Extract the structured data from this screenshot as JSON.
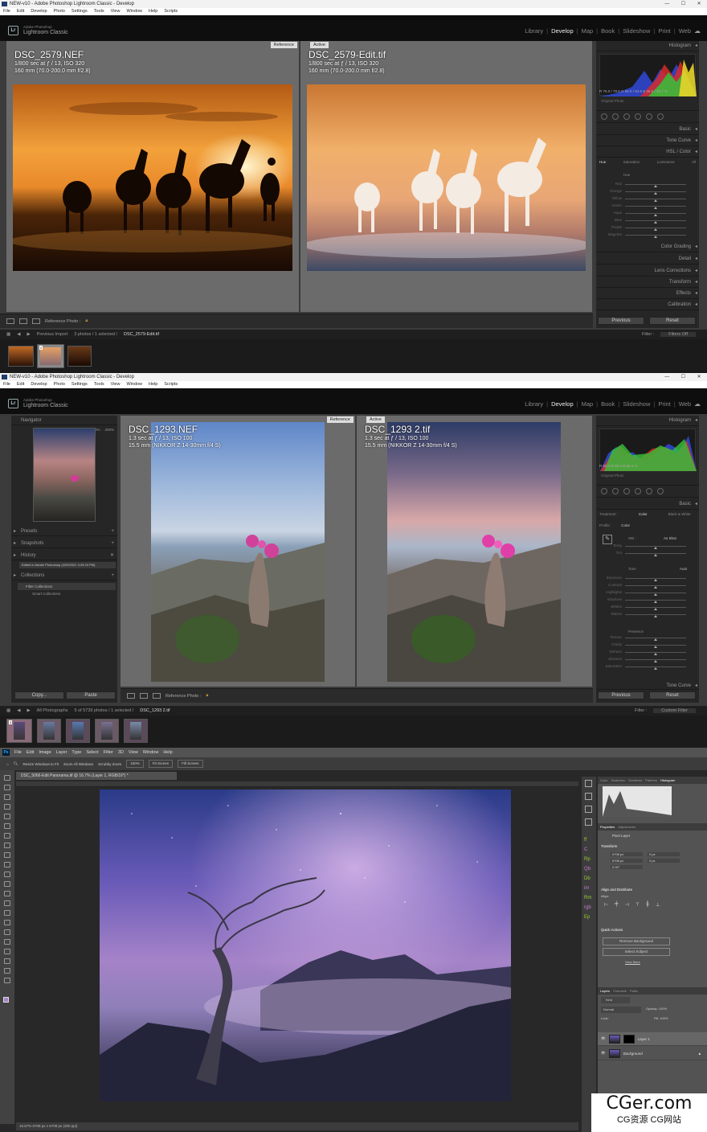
{
  "lr1": {
    "window_title": "NEW-v10 - Adobe Photoshop Lightroom Classic - Develop",
    "menus": [
      "File",
      "Edit",
      "Develop",
      "Photo",
      "Settings",
      "Tools",
      "View",
      "Window",
      "Help",
      "Scripts"
    ],
    "app_small": "Adobe Photoshop",
    "app_name": "Lightroom Classic",
    "modules": [
      "Library",
      "Develop",
      "Map",
      "Book",
      "Slideshow",
      "Print",
      "Web"
    ],
    "active_module": "Develop",
    "reference_tag": "Reference",
    "active_tag": "Active",
    "ref_file": "DSC_2579.NEF",
    "ref_exposure": "1/800 sec at ƒ / 13, ISO 320",
    "ref_lens": "160 mm (70.0-200.0 mm f/2.8)",
    "act_file": "DSC_2579-Edit.tif",
    "act_exposure": "1/800 sec at ƒ / 13, ISO 320",
    "act_lens": "160 mm (70.0-200.0 mm f/2.8)",
    "histogram_title": "Histogram",
    "rgb_readout": "R 76.0 / 78.5  G 65.0 / 63.5  B 36.5 / 39.7 %",
    "original_photo": "Original Photo",
    "panels": [
      "Basic",
      "Tone Curve"
    ],
    "hsl_title": "HSL / Color",
    "hsl_tabs": [
      "Hue",
      "Saturation",
      "Luminance",
      "All"
    ],
    "hsl_label": "Hue",
    "hsl_sliders": [
      "Red",
      "Orange",
      "Yellow",
      "Green",
      "Aqua",
      "Blue",
      "Purple",
      "Magenta"
    ],
    "panels_after": [
      "Color Grading",
      "Detail",
      "Lens Corrections",
      "Transform",
      "Effects",
      "Calibration"
    ],
    "previous": "Previous",
    "reset": "Reset",
    "toolbar_ref": "Reference Photo :",
    "film_source": "Previous Import",
    "film_count": "3 photos / 1 selected /",
    "film_file": "DSC_2579-Edit.tif",
    "filter_label": "Filter :",
    "filter_value": "Filters Off",
    "thumb_badge": "2"
  },
  "lr2": {
    "window_title": "NEW-v10 - Adobe Photoshop Lightroom Classic - Develop",
    "menus": [
      "File",
      "Edit",
      "Develop",
      "Photo",
      "Settings",
      "Tools",
      "View",
      "Window",
      "Help",
      "Scripts"
    ],
    "app_small": "Adobe Photoshop",
    "app_name": "Lightroom Classic",
    "modules": [
      "Library",
      "Develop",
      "Map",
      "Book",
      "Slideshow",
      "Print",
      "Web"
    ],
    "active_module": "Develop",
    "navigator": "Navigator",
    "nav_zoom": [
      "FIT",
      "100%",
      "200%"
    ],
    "left_sections": [
      "Presets",
      "Snapshots",
      "History",
      "Collections"
    ],
    "history_item": "Edited in Adobe Photoshop (4/29/2021 4:29:23 PM)",
    "filter_collections": "Filter Collections",
    "smart_collections": "Smart Collections",
    "copy": "Copy...",
    "paste": "Paste",
    "reference_tag": "Reference",
    "active_tag": "Active",
    "ref_file": "DSC_1293.NEF",
    "ref_exposure": "1.3 sec at ƒ / 13, ISO 100",
    "ref_lens": "15.5 mm (NIKKOR Z 14-30mm f/4 S)",
    "act_file": "DSC_1293 2.tif",
    "act_exposure": "1.3 sec at ƒ / 13, ISO 100",
    "act_lens": "15.5 mm (NIKKOR Z 14-30mm f/4 S)",
    "histogram_title": "Histogram",
    "rgb_readout": "R 90.4  G 80.3  B 66.1 %",
    "original_photo": "Original Photo",
    "basic_title": "Basic",
    "treatment": "Treatment :",
    "color": "Color",
    "bw": "Black & White",
    "profile": "Profile :",
    "profile_value": "Color",
    "wb": "WB :",
    "wb_value": "As Shot",
    "tone": "Tone",
    "auto": "Auto",
    "presence": "Presence",
    "tone_sliders": [
      "Temp",
      "Tint",
      "Exposure",
      "Contrast",
      "Highlights",
      "Shadows",
      "Whites",
      "Blacks"
    ],
    "presence_sliders": [
      "Texture",
      "Clarity",
      "Dehaze",
      "Vibrance",
      "Saturation"
    ],
    "tone_curve": "Tone Curve",
    "previous": "Previous",
    "reset": "Reset",
    "toolbar_ref": "Reference Photo :",
    "film_source": "All Photographs",
    "film_count": "5 of 5739 photos / 1 selected /",
    "film_file": "DSC_1293 2.tif",
    "filter_label": "Filter :",
    "filter_value": "Custom Filter",
    "thumb_badge": "3"
  },
  "ps": {
    "menus": [
      "File",
      "Edit",
      "Image",
      "Layer",
      "Type",
      "Select",
      "Filter",
      "3D",
      "View",
      "Window",
      "Help"
    ],
    "options": [
      "Resize Windows to Fit",
      "Zoom All Windows",
      "Scrubby Zoom",
      "100%",
      "Fit Screen",
      "Fill Screen"
    ],
    "doc_tab": "DSC_5066-Edit Panorama.tif @ 16.7% (Layer 1, RGB/16*) *",
    "right_tabs": [
      "Color",
      "Swatches",
      "Gradients",
      "Patterns",
      "Histogram"
    ],
    "prop_tabs": [
      "Properties",
      "Adjustments"
    ],
    "pixel_layer": "Pixel Layer",
    "transform": "Transform",
    "w1": "6708 px",
    "h1": "6708 px",
    "x": "0 px",
    "y": "0 px",
    "angle": "0.00°",
    "align": "Align and Distribute",
    "align_label": "Align:",
    "quick": "Quick Actions",
    "remove_bg": "Remove Background",
    "select_subject": "Select Subject",
    "view_more": "View More",
    "layer_tabs": [
      "Layers",
      "Channels",
      "Paths"
    ],
    "kind": "Kind",
    "blend": "Normal",
    "opacity": "Opacity: 100%",
    "lock": "Lock:",
    "fill": "Fill: 100%",
    "layer1": "Layer 1",
    "background": "Background",
    "status": "16.67%    6708 px x 6708 px (300 ppi)",
    "side_icons": [
      "ff",
      "C",
      "Rp",
      "Qb",
      "Db",
      "im",
      "Rm",
      "rgb",
      "Ep"
    ]
  },
  "watermark": {
    "site": "CGer.com",
    "sub": "CG资源 CG网站"
  },
  "colors": {
    "accent": "#31a8ff",
    "lr_bg": "#3b3b3b",
    "ps_bg": "#282828"
  }
}
